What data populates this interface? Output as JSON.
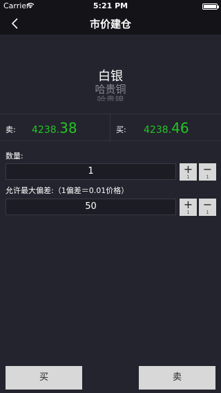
{
  "status": {
    "carrier": "Carrier",
    "time": "5:21 PM"
  },
  "nav": {
    "title": "市价建仓"
  },
  "picker": {
    "items": [
      "白银",
      "哈贵铜",
      "哈贵镍"
    ]
  },
  "prices": {
    "sell": {
      "label": "卖:",
      "int": "4238.",
      "dec": "38"
    },
    "buy": {
      "label": "买:",
      "int": "4238.",
      "dec": "46"
    }
  },
  "quantity": {
    "label": "数量:",
    "value": "1",
    "plus": "+",
    "minus": "−",
    "step": "1"
  },
  "deviation": {
    "label": "允许最大偏差:（1偏差＝0.01价格）",
    "value": "50",
    "plus": "+",
    "minus": "−",
    "step": "1"
  },
  "actions": {
    "buy": "买",
    "sell": "卖"
  },
  "colors": {
    "price": "#23c526",
    "background": "#24242e",
    "bar": "#141418"
  }
}
